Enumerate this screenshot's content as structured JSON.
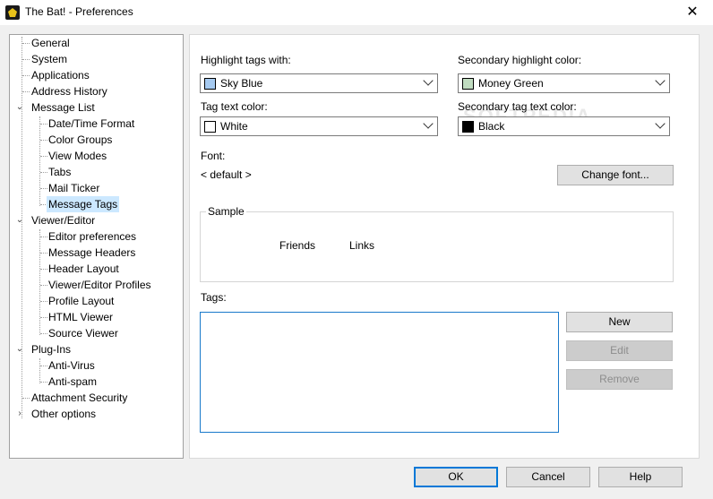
{
  "window": {
    "title": "The Bat! - Preferences",
    "close_glyph": "✕"
  },
  "tree": {
    "items": [
      {
        "label": "General"
      },
      {
        "label": "System"
      },
      {
        "label": "Applications"
      },
      {
        "label": "Address History"
      },
      {
        "label": "Message List"
      },
      {
        "label": "Date/Time Format"
      },
      {
        "label": "Color Groups"
      },
      {
        "label": "View Modes"
      },
      {
        "label": "Tabs"
      },
      {
        "label": "Mail Ticker"
      },
      {
        "label": "Message Tags",
        "selected": true
      },
      {
        "label": "Viewer/Editor"
      },
      {
        "label": "Editor preferences"
      },
      {
        "label": "Message Headers"
      },
      {
        "label": "Header Layout"
      },
      {
        "label": "Viewer/Editor Profiles"
      },
      {
        "label": "Profile Layout"
      },
      {
        "label": "HTML Viewer"
      },
      {
        "label": "Source Viewer"
      },
      {
        "label": "Plug-Ins"
      },
      {
        "label": "Anti-Virus"
      },
      {
        "label": "Anti-spam"
      },
      {
        "label": "Attachment Security"
      },
      {
        "label": "Other options"
      }
    ]
  },
  "settings": {
    "highlight": {
      "label": "Highlight tags with:",
      "value": "Sky Blue",
      "color": "#a6caf0"
    },
    "secondary_highlight": {
      "label": "Secondary highlight color:",
      "value": "Money Green",
      "color": "#c0dcc0"
    },
    "tag_text": {
      "label": "Tag text color:",
      "value": "White",
      "color": "#ffffff"
    },
    "secondary_tag_text": {
      "label": "Secondary tag text color:",
      "value": "Black",
      "color": "#000000"
    },
    "font": {
      "label": "Font:",
      "value": "< default >",
      "change_button": "Change font..."
    },
    "sample": {
      "label": "Sample",
      "words": [
        "Friends",
        "Links"
      ]
    },
    "tags": {
      "label": "Tags:",
      "new_button": "New",
      "edit_button": "Edit",
      "remove_button": "Remove"
    }
  },
  "footer": {
    "ok": "OK",
    "cancel": "Cancel",
    "help": "Help"
  },
  "watermark": "SOFTPEDIA"
}
